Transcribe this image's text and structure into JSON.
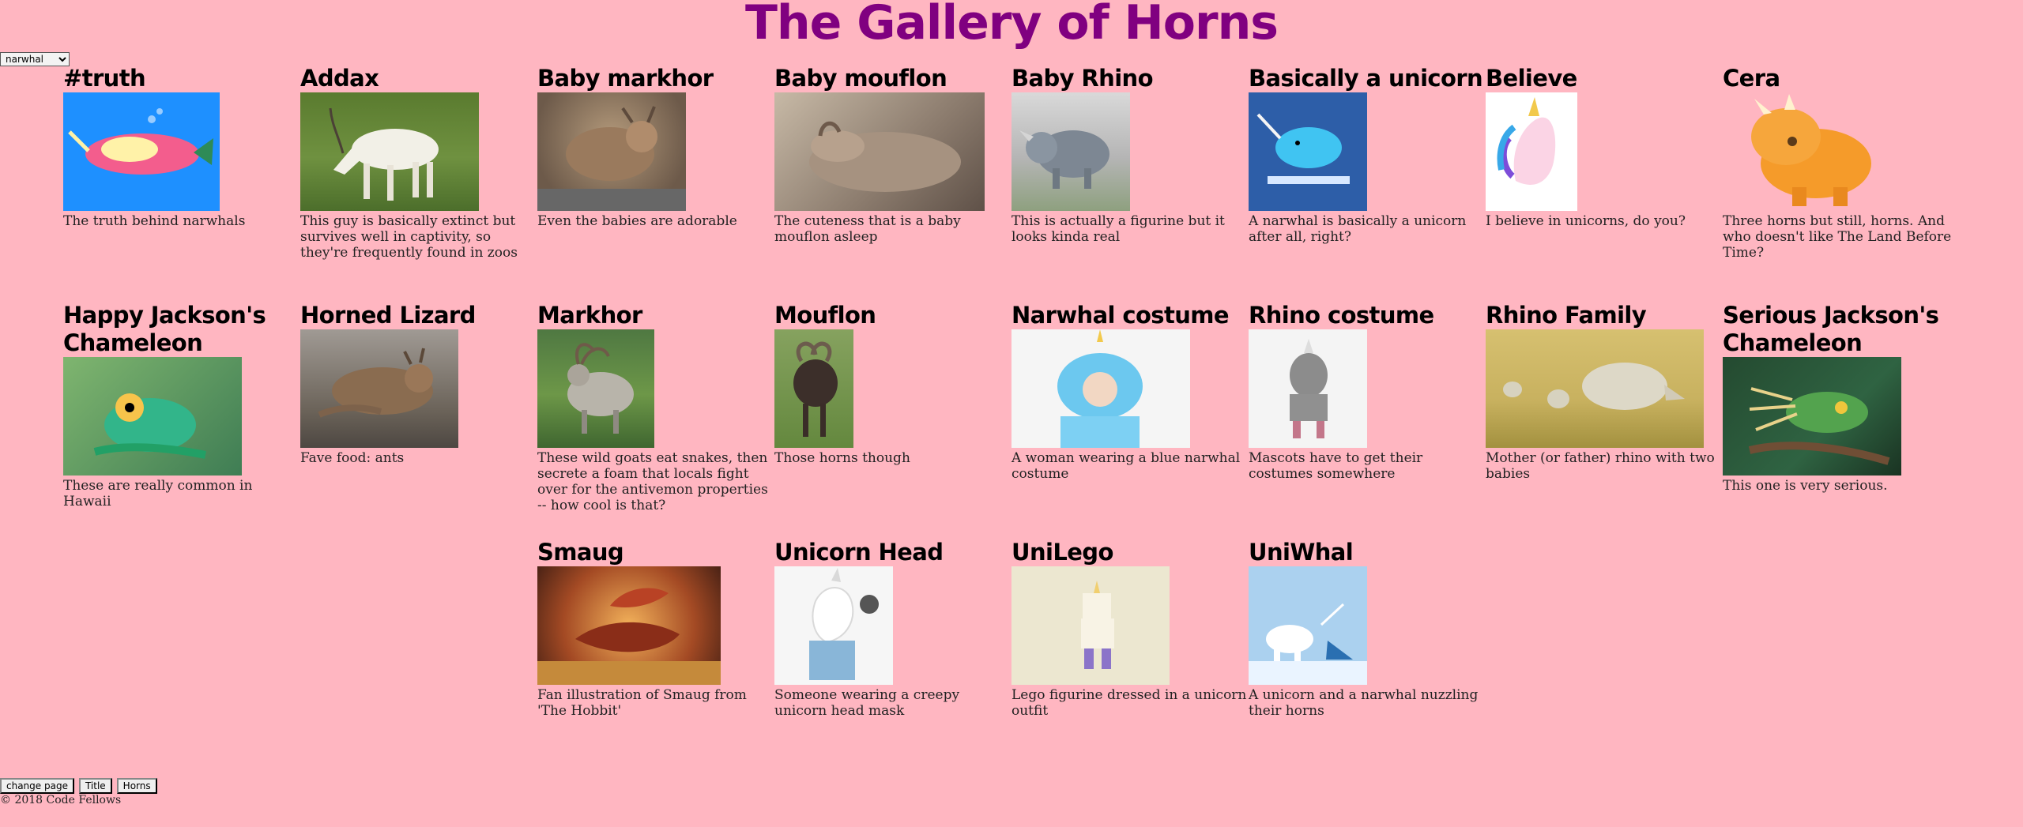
{
  "page": {
    "title": "The Gallery of Horns",
    "select_value": "narwhal",
    "footer_buttons": [
      "change page",
      "Title",
      "Horns"
    ],
    "copyright": "© 2018 Code Fellows"
  },
  "colors": {
    "background": "#ffb6c1",
    "title": "#800080"
  },
  "horns": [
    {
      "title": "#truth",
      "desc": "The truth behind narwhals",
      "image": "narwhal-cartoon-illustration",
      "img_bg": "#1e90ff"
    },
    {
      "title": "Addax",
      "desc": "This guy is basically extinct but survives well in captivity, so they're frequently found in zoos",
      "image": "white-antelope-photo",
      "img_bg": "#6f8f3f"
    },
    {
      "title": "Baby markhor",
      "desc": "Even the babies are adorable",
      "image": "baby-goat-photo",
      "img_bg": "#8a7563"
    },
    {
      "title": "Baby mouflon",
      "desc": "The cuteness that is a baby mouflon asleep",
      "image": "sleeping-mouflon-photo",
      "img_bg": "#9b8b7a"
    },
    {
      "title": "Baby Rhino",
      "desc": "This is actually a figurine but it looks kinda real",
      "image": "rhino-figurine-photo",
      "img_bg": "#7a8a7a"
    },
    {
      "title": "Basically a unicorn",
      "desc": "A narwhal is basically a unicorn after all, right?",
      "image": "narwhal-shirt-graphic",
      "img_bg": "#2d5ea8"
    },
    {
      "title": "Believe",
      "desc": "I believe in unicorns, do you?",
      "image": "unicorn-head-drawing",
      "img_bg": "#ffffff"
    },
    {
      "title": "Cera",
      "desc": "Three horns but still, horns. And who doesn't like The Land Before Time?",
      "image": "orange-triceratops-cartoon",
      "img_bg": "#ffb6c1"
    },
    {
      "title": "Happy Jackson's Chameleon",
      "desc": "These are really common in Hawaii",
      "image": "green-chameleon-photo",
      "img_bg": "#4f8f5a"
    },
    {
      "title": "Horned Lizard",
      "desc": "Fave food: ants",
      "image": "horned-lizard-photo",
      "img_bg": "#7c6f63"
    },
    {
      "title": "Markhor",
      "desc": "These wild goats eat snakes, then secrete a foam that locals fight over for the antivemon properties -- how cool is that?",
      "image": "markhor-goat-photo",
      "img_bg": "#5b7d43"
    },
    {
      "title": "Mouflon",
      "desc": "Those horns though",
      "image": "mouflon-ram-photo",
      "img_bg": "#5d7d3c"
    },
    {
      "title": "Narwhal costume",
      "desc": "A woman wearing a blue narwhal costume",
      "image": "narwhal-costume-photo",
      "img_bg": "#5fb3dc"
    },
    {
      "title": "Rhino costume",
      "desc": "Mascots have to get their costumes somewhere",
      "image": "rhino-mascot-photo",
      "img_bg": "#f0f0f0"
    },
    {
      "title": "Rhino Family",
      "desc": "Mother (or father) rhino with two babies",
      "image": "rhino-family-photo",
      "img_bg": "#c9b26a"
    },
    {
      "title": "Serious Jackson's Chameleon",
      "desc": "This one is very serious.",
      "image": "serious-chameleon-photo",
      "img_bg": "#2f5a3b"
    },
    {
      "title": "Smaug",
      "desc": "Fan illustration of Smaug from 'The Hobbit'",
      "image": "dragon-illustration",
      "img_bg": "#a8542a"
    },
    {
      "title": "Unicorn Head",
      "desc": "Someone wearing a creepy unicorn head mask",
      "image": "unicorn-mask-photo",
      "img_bg": "#f5f5f5"
    },
    {
      "title": "UniLego",
      "desc": "Lego figurine dressed in a unicorn outfit",
      "image": "lego-unicorn-photo",
      "img_bg": "#e8e2c8"
    },
    {
      "title": "UniWhal",
      "desc": "A unicorn and a narwhal nuzzling their horns",
      "image": "unicorn-narwhal-illustration",
      "img_bg": "#a9cfee"
    }
  ]
}
